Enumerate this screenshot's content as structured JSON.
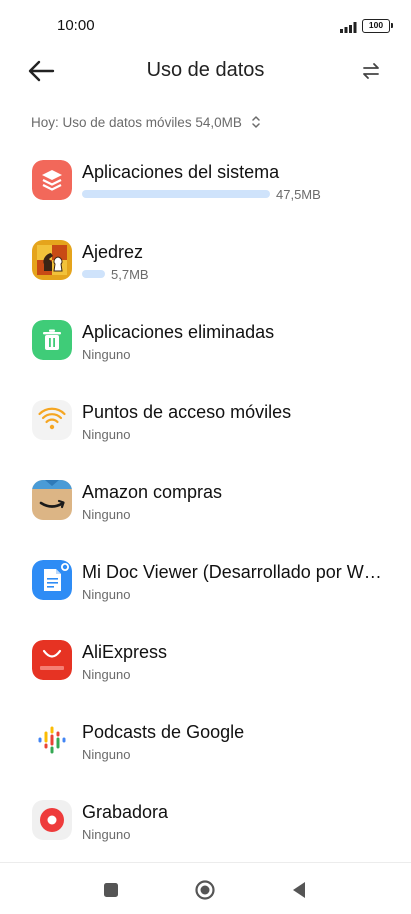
{
  "status": {
    "time": "10:00",
    "battery": "100",
    "signal_icon": "signal-icon",
    "battery_icon": "battery-icon"
  },
  "header": {
    "title": "Uso de datos",
    "back_icon": "back-arrow-icon",
    "filter_icon": "swap-icon"
  },
  "summary": {
    "label": "Hoy: Uso de datos móviles 54,0MB",
    "icon": "chevron-up-down-icon"
  },
  "apps": [
    {
      "name": "Aplicaciones del sistema",
      "usage": "47,5MB",
      "usage_fraction": 1.0,
      "icon": "system-apps-icon",
      "color": "#f06a5b"
    },
    {
      "name": "Ajedrez",
      "usage": "5,7MB",
      "usage_fraction": 0.12,
      "icon": "chess-icon",
      "color": "#e4a11b"
    },
    {
      "name": "Aplicaciones eliminadas",
      "sub": "Ninguno",
      "icon": "trash-icon",
      "color": "#43cc78"
    },
    {
      "name": "Puntos de acceso móviles",
      "sub": "Ninguno",
      "icon": "wifi-hotspot-icon",
      "color": "#f5a623"
    },
    {
      "name": "Amazon compras",
      "sub": "Ninguno",
      "icon": "amazon-icon",
      "color": "#d9b382"
    },
    {
      "name": "Mi Doc Viewer (Desarrollado por WPS Office)",
      "sub": "Ninguno",
      "icon": "doc-viewer-icon",
      "color": "#2f8cf6"
    },
    {
      "name": "AliExpress",
      "sub": "Ninguno",
      "icon": "aliexpress-icon",
      "color": "#e43225"
    },
    {
      "name": "Podcasts de Google",
      "sub": "Ninguno",
      "icon": "google-podcasts-icon",
      "color": "#ffffff"
    },
    {
      "name": "Grabadora",
      "sub": "Ninguno",
      "icon": "recorder-icon",
      "color": "#ee3b3b"
    }
  ],
  "nav": {
    "recents_icon": "square-icon",
    "home_icon": "circle-home-icon",
    "back_icon": "triangle-back-icon"
  }
}
